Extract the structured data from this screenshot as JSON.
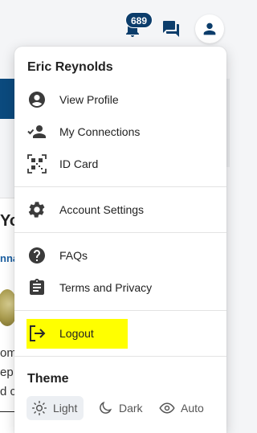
{
  "header": {
    "notification_count": "689"
  },
  "menu": {
    "user_name": "Eric Reynolds",
    "items": [
      {
        "label": "View Profile",
        "icon": "account-circle-icon"
      },
      {
        "label": "My Connections",
        "icon": "connections-icon"
      },
      {
        "label": "ID Card",
        "icon": "qr-code-icon"
      },
      {
        "label": "Account Settings",
        "icon": "gear-icon"
      },
      {
        "label": "FAQs",
        "icon": "help-circle-icon"
      },
      {
        "label": "Terms and Privacy",
        "icon": "clipboard-icon"
      },
      {
        "label": "Logout",
        "icon": "logout-icon"
      }
    ],
    "theme": {
      "title": "Theme",
      "options": [
        {
          "label": "Light",
          "icon": "sun-icon",
          "selected": true
        },
        {
          "label": "Dark",
          "icon": "moon-icon",
          "selected": false
        },
        {
          "label": "Auto",
          "icon": "eye-icon",
          "selected": false
        }
      ]
    }
  },
  "background": {
    "heading_fragment": "Yo",
    "link_fragment": "nna",
    "text_lines": [
      "om",
      "ep",
      "d c"
    ]
  },
  "colors": {
    "highlight": "#ffff00",
    "brand_dark": "#0c3d6b"
  }
}
